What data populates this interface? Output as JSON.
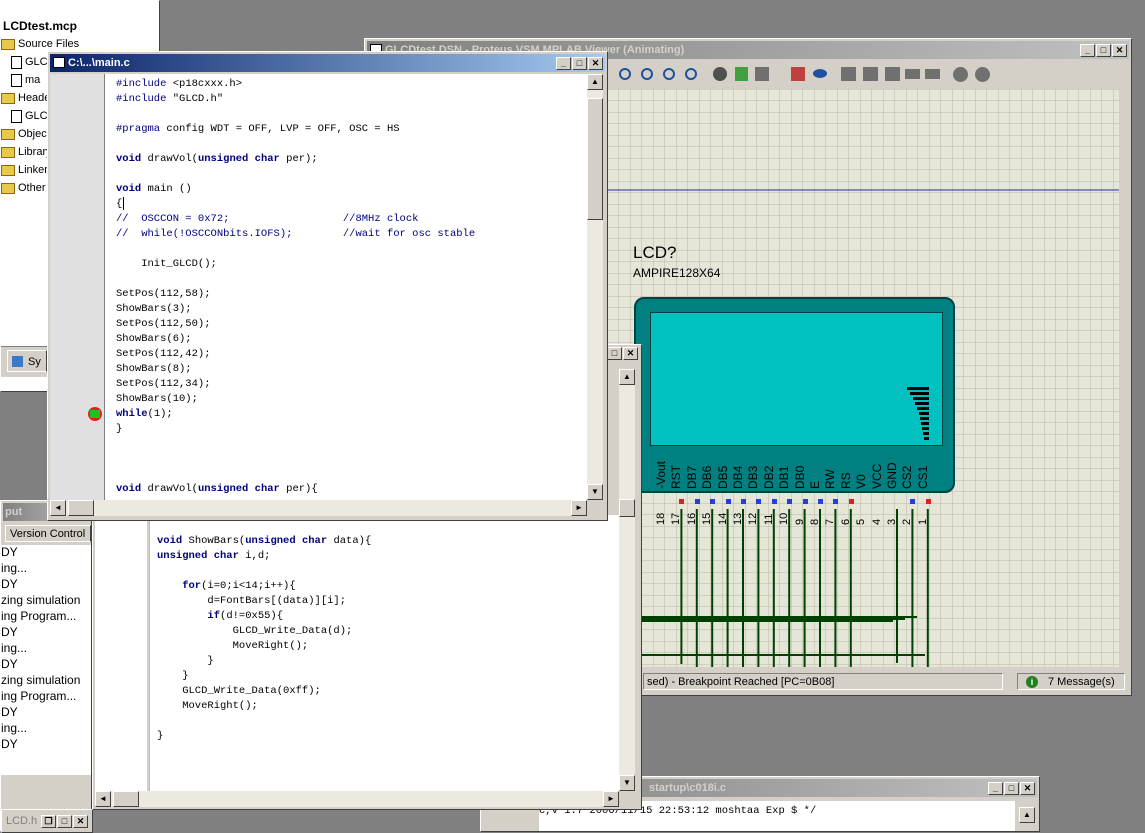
{
  "project": {
    "title": "LCDtest.mcp",
    "items": [
      {
        "label": "Source Files",
        "kind": "folder"
      },
      {
        "label": "GLC",
        "kind": "file"
      },
      {
        "label": "ma",
        "kind": "file"
      },
      {
        "label": "Header",
        "kind": "folder"
      },
      {
        "label": "GLC",
        "kind": "file"
      },
      {
        "label": "Object",
        "kind": "folder"
      },
      {
        "label": "Library",
        "kind": "folder"
      },
      {
        "label": "Linker S",
        "kind": "folder"
      },
      {
        "label": "Other F",
        "kind": "folder"
      }
    ],
    "tab": "Sy"
  },
  "output": {
    "title": "put",
    "tab": "Version Control",
    "lines": [
      "DY",
      "ing...",
      "DY",
      "zing simulation",
      "ing Program...",
      "DY",
      "ing...",
      "DY",
      "zing simulation",
      "ing Program...",
      "DY",
      "ing...",
      "DY"
    ]
  },
  "main_editor": {
    "title": "C:\\...\\main.c",
    "lines": [
      [
        {
          "t": "#include ",
          "c": "pp"
        },
        {
          "t": "<p18cxxx.h>",
          "c": ""
        }
      ],
      [
        {
          "t": "#include ",
          "c": "pp"
        },
        {
          "t": "\"GLCD.h\"",
          "c": ""
        }
      ],
      [],
      [
        {
          "t": "#pragma ",
          "c": "pp"
        },
        {
          "t": "config WDT = OFF, LVP = OFF, OSC = HS",
          "c": ""
        }
      ],
      [],
      [
        {
          "t": "void ",
          "c": "kw"
        },
        {
          "t": "drawVol(",
          "c": ""
        },
        {
          "t": "unsigned char ",
          "c": "kw"
        },
        {
          "t": "per);",
          "c": ""
        }
      ],
      [],
      [
        {
          "t": "void ",
          "c": "kw"
        },
        {
          "t": "main ()",
          "c": ""
        }
      ],
      [
        {
          "t": "{",
          "c": ""
        }
      ],
      [
        {
          "t": "//  OSCCON = 0x72;                  //8MHz clock",
          "c": "cm"
        }
      ],
      [
        {
          "t": "//  while(!OSCCONbits.IOFS);        //wait for osc stable",
          "c": "cm"
        }
      ],
      [],
      [
        {
          "t": "    Init_GLCD();",
          "c": ""
        }
      ],
      [],
      [
        {
          "t": "SetPos(112,58);",
          "c": ""
        }
      ],
      [
        {
          "t": "ShowBars(3);",
          "c": ""
        }
      ],
      [
        {
          "t": "SetPos(112,50);",
          "c": ""
        }
      ],
      [
        {
          "t": "ShowBars(6);",
          "c": ""
        }
      ],
      [
        {
          "t": "SetPos(112,42);",
          "c": ""
        }
      ],
      [
        {
          "t": "ShowBars(8);",
          "c": ""
        }
      ],
      [
        {
          "t": "SetPos(112,34);",
          "c": ""
        }
      ],
      [
        {
          "t": "ShowBars(10);",
          "c": ""
        }
      ],
      [
        {
          "t": "while",
          "c": "kw"
        },
        {
          "t": "(1);",
          "c": ""
        }
      ],
      [
        {
          "t": "}",
          "c": ""
        }
      ],
      [],
      [],
      [],
      [
        {
          "t": "void ",
          "c": "kw"
        },
        {
          "t": "drawVol(",
          "c": ""
        },
        {
          "t": "unsigned char ",
          "c": "kw"
        },
        {
          "t": "per){",
          "c": ""
        }
      ]
    ]
  },
  "second_editor": {
    "lines": [
      [
        {
          "t": "void ",
          "c": "kw"
        },
        {
          "t": "ShowBars(",
          "c": ""
        },
        {
          "t": "unsigned char ",
          "c": "kw"
        },
        {
          "t": "data){",
          "c": ""
        }
      ],
      [
        {
          "t": "unsigned char ",
          "c": "kw"
        },
        {
          "t": "i,d;",
          "c": ""
        }
      ],
      [],
      [
        {
          "t": "    for",
          "c": "kw"
        },
        {
          "t": "(i=0;i<14;i++){",
          "c": ""
        }
      ],
      [
        {
          "t": "        d=FontBars[(data)][i];",
          "c": ""
        }
      ],
      [
        {
          "t": "        if",
          "c": "kw"
        },
        {
          "t": "(d!=0x55){",
          "c": ""
        }
      ],
      [
        {
          "t": "            GLCD_Write_Data(d);",
          "c": ""
        }
      ],
      [
        {
          "t": "            MoveRight();",
          "c": ""
        }
      ],
      [
        {
          "t": "        }",
          "c": ""
        }
      ],
      [
        {
          "t": "    }",
          "c": ""
        }
      ],
      [
        {
          "t": "    GLCD_Write_Data(0xff);",
          "c": ""
        }
      ],
      [
        {
          "t": "    MoveRight();",
          "c": ""
        }
      ],
      [],
      [
        {
          "t": "}",
          "c": ""
        }
      ]
    ]
  },
  "proteus": {
    "title": "GLCDtest.DSN - Proteus VSM MPLAB Viewer (Animating)",
    "component_ref": "LCD?",
    "component_part": "AMPIRE128X64",
    "status_text": "sed) - Breakpoint Reached [PC=0B08]",
    "messages": "7 Message(s)",
    "pins": [
      {
        "label": "-Vout",
        "num": "18"
      },
      {
        "label": "RST",
        "num": "17"
      },
      {
        "label": "DB7",
        "num": "16"
      },
      {
        "label": "DB6",
        "num": "15"
      },
      {
        "label": "DB5",
        "num": "14"
      },
      {
        "label": "DB4",
        "num": "13"
      },
      {
        "label": "DB3",
        "num": "12"
      },
      {
        "label": "DB2",
        "num": "11"
      },
      {
        "label": "DB1",
        "num": "10"
      },
      {
        "label": "DB0",
        "num": "9"
      },
      {
        "label": "E",
        "num": "8"
      },
      {
        "label": "RW",
        "num": "7"
      },
      {
        "label": "RS",
        "num": "6"
      },
      {
        "label": "V0",
        "num": "5"
      },
      {
        "label": "VCC",
        "num": "4"
      },
      {
        "label": "GND",
        "num": "3"
      },
      {
        "label": "CS2",
        "num": "2"
      },
      {
        "label": "CS1",
        "num": "1"
      }
    ],
    "colors": {
      "lcd_body": "#008080",
      "lcd_screen": "#00c0c0",
      "wire": "#004000",
      "grid_bg": "#e6e6d8"
    }
  },
  "startup_editor": {
    "title": "startup\\c018i.c",
    "line": "c,v 1.7 2006/11/15 22:53:12 moshtaa Exp $ */"
  },
  "bottom_tab": {
    "label": "LCD.h"
  }
}
